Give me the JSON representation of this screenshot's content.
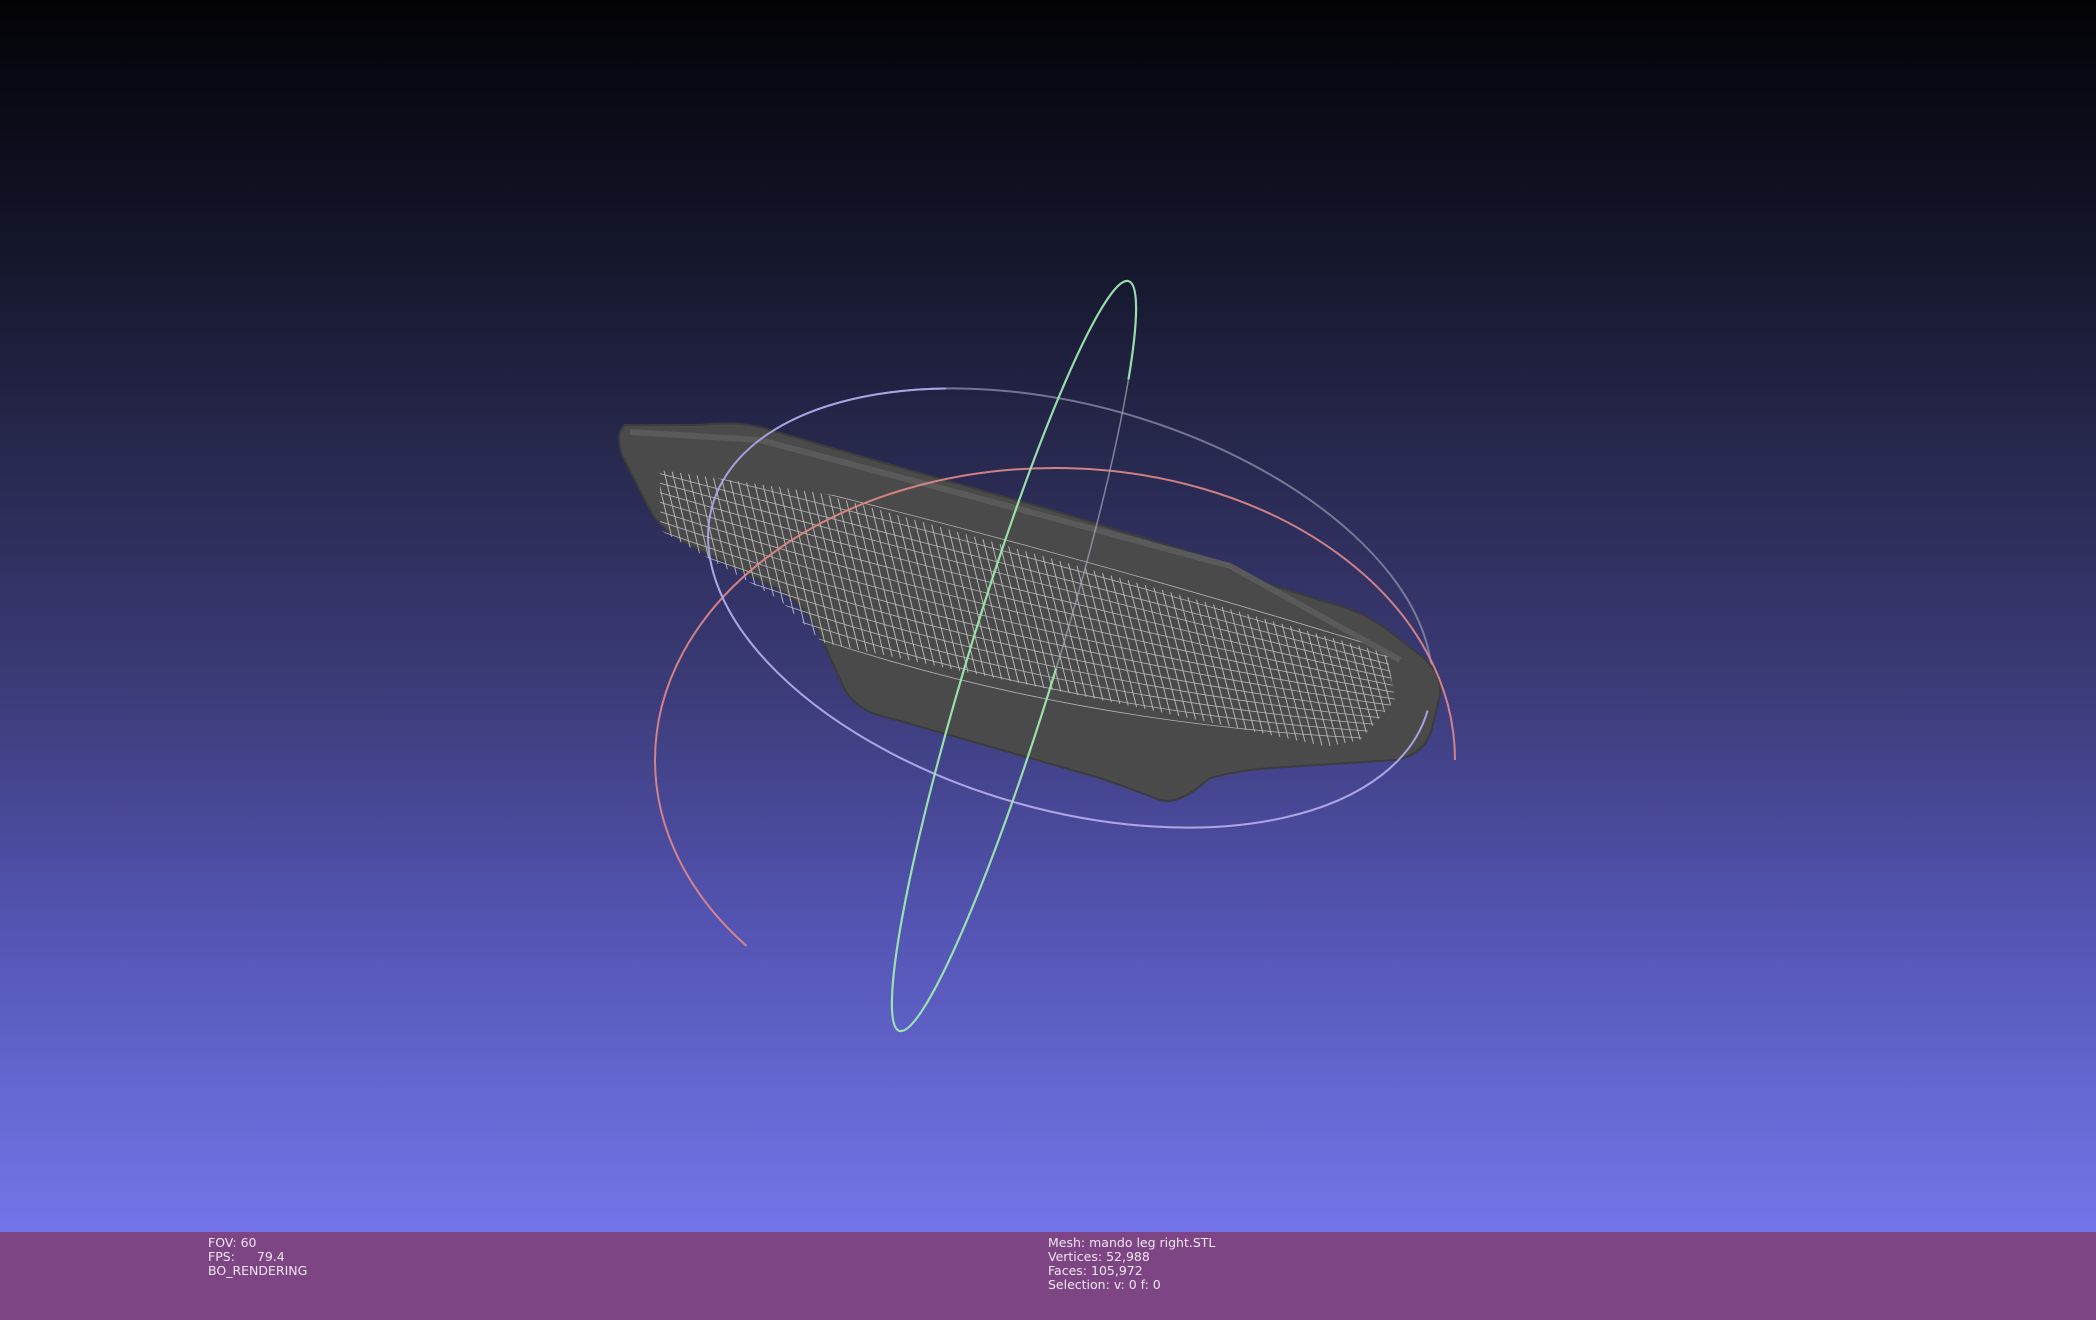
{
  "viewport": {
    "background_top": "#020206",
    "background_bottom": "#7474ea"
  },
  "scene": {
    "mesh_color": "#4a4a4a",
    "wire_color": "#d8d8d8",
    "trackball": {
      "x_ring_color": "#e08a8a",
      "y_ring_color": "#9ee8b0",
      "z_ring_color": "#b0a8ee"
    }
  },
  "info_left": {
    "fov_label": "FOV:",
    "fov_value": "60",
    "fps_label": "FPS:",
    "fps_value": "79.4",
    "render_mode": "BO_RENDERING"
  },
  "info_right": {
    "mesh_label": "Mesh:",
    "mesh_value": "mando leg right.STL",
    "vertices_label": "Vertices:",
    "vertices_value": "52,988",
    "faces_label": "Faces:",
    "faces_value": "105,972",
    "selection_label": "Selection:",
    "selection_value": "v: 0 f: 0"
  },
  "colors": {
    "info_bar_bg": "#7e4585",
    "info_text": "#f0e6f0"
  }
}
